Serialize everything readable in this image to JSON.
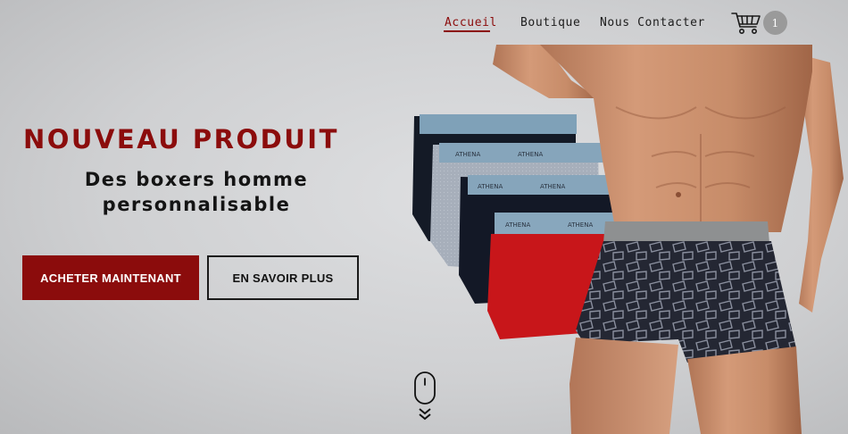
{
  "nav": {
    "items": [
      {
        "label": "Accueil",
        "active": true
      },
      {
        "label": "Boutique",
        "active": false
      },
      {
        "label": "Nous Contacter",
        "active": false
      }
    ],
    "cart_icon": "shopping-cart-icon",
    "cart_count": "1"
  },
  "hero": {
    "title": "NOUVEAU PRODUIT",
    "subtitle_line1": "Des boxers homme",
    "subtitle_line2": "personnalisable",
    "primary_button": "ACHETER MAINTENANT",
    "secondary_button": "EN SAVOIR PLUS",
    "scroll_icon": "mouse-scroll-down-icon",
    "waistband_text": "ATHENA"
  },
  "colors": {
    "brand": "#8b0c0c",
    "text": "#141414",
    "background": "#d2d3d5",
    "badge": "#9a9a9a"
  }
}
